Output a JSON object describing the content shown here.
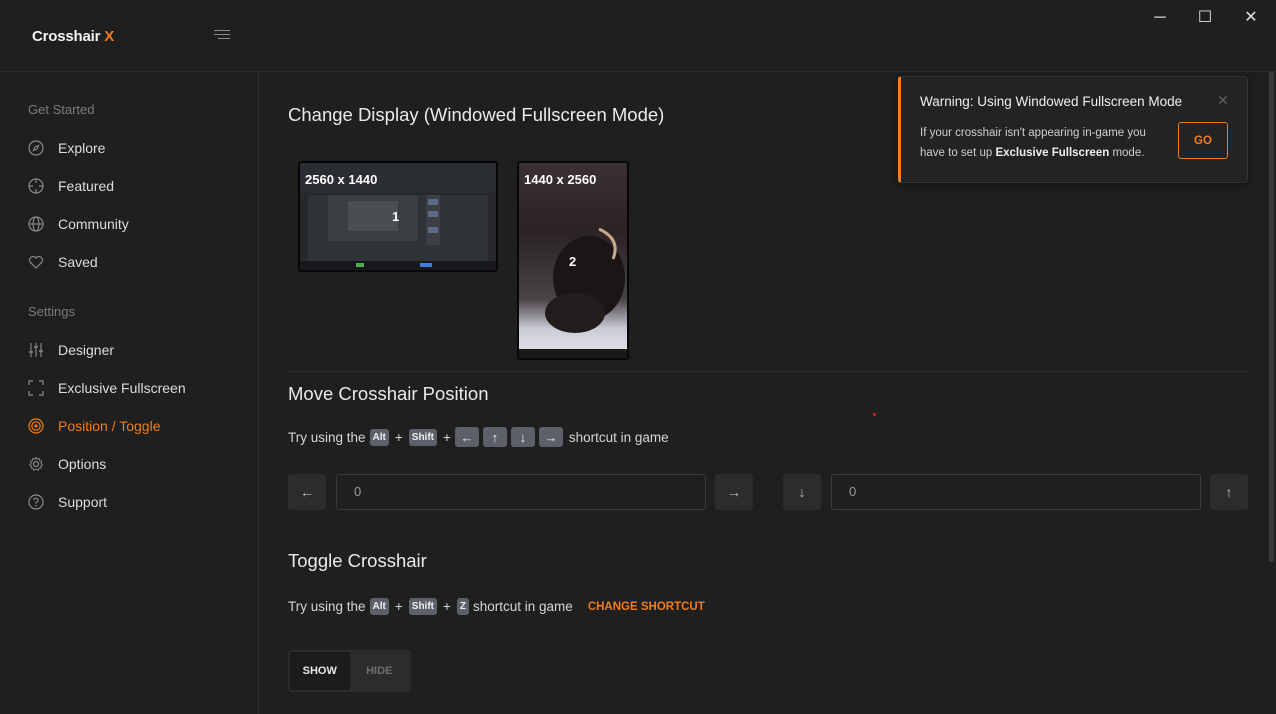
{
  "app": {
    "logo_text": "Crosshair",
    "logo_accent": "X",
    "accent_color": "#f07d1a"
  },
  "window_controls": {
    "minimize": "─",
    "maximize": "☐",
    "close": "✕"
  },
  "sidebar": {
    "group_get_started": "Get Started",
    "group_settings": "Settings",
    "items": [
      {
        "label": "Explore",
        "icon": "compass-icon"
      },
      {
        "label": "Featured",
        "icon": "target-icon"
      },
      {
        "label": "Community",
        "icon": "globe-icon"
      },
      {
        "label": "Saved",
        "icon": "heart-icon"
      },
      {
        "label": "Designer",
        "icon": "sliders-icon"
      },
      {
        "label": "Exclusive Fullscreen",
        "icon": "fullscreen-icon"
      },
      {
        "label": "Position / Toggle",
        "icon": "crosshair-icon",
        "active": true
      },
      {
        "label": "Options",
        "icon": "gear-icon"
      },
      {
        "label": "Support",
        "icon": "help-icon"
      }
    ]
  },
  "display": {
    "title": "Change Display (Windowed Fullscreen Mode)",
    "monitors": [
      {
        "resolution": "2560 x 1440",
        "number": "1"
      },
      {
        "resolution": "1440 x 2560",
        "number": "2"
      }
    ]
  },
  "move": {
    "title": "Move Crosshair Position",
    "hint_prefix": "Try using the",
    "hint_suffix": "shortcut in game",
    "key_alt": "Alt",
    "key_shift": "Shift",
    "plus": "+",
    "arrows": [
      "←",
      "↑",
      "↓",
      "→"
    ],
    "x_value": "0",
    "y_value": "0"
  },
  "toggle": {
    "title": "Toggle Crosshair",
    "hint_prefix": "Try using the",
    "hint_suffix": "shortcut in game",
    "key_alt": "Alt",
    "key_shift": "Shift",
    "key_z": "Z",
    "plus": "+",
    "change_shortcut": "CHANGE SHORTCUT",
    "show_label": "SHOW",
    "hide_label": "HIDE"
  },
  "toast": {
    "title": "Warning: Using Windowed Fullscreen Mode",
    "close": "✕",
    "body_prefix": "If your crosshair isn't appearing in-game you have to set up ",
    "body_bold": "Exclusive Fullscreen",
    "body_suffix": " mode.",
    "go_label": "GO"
  }
}
